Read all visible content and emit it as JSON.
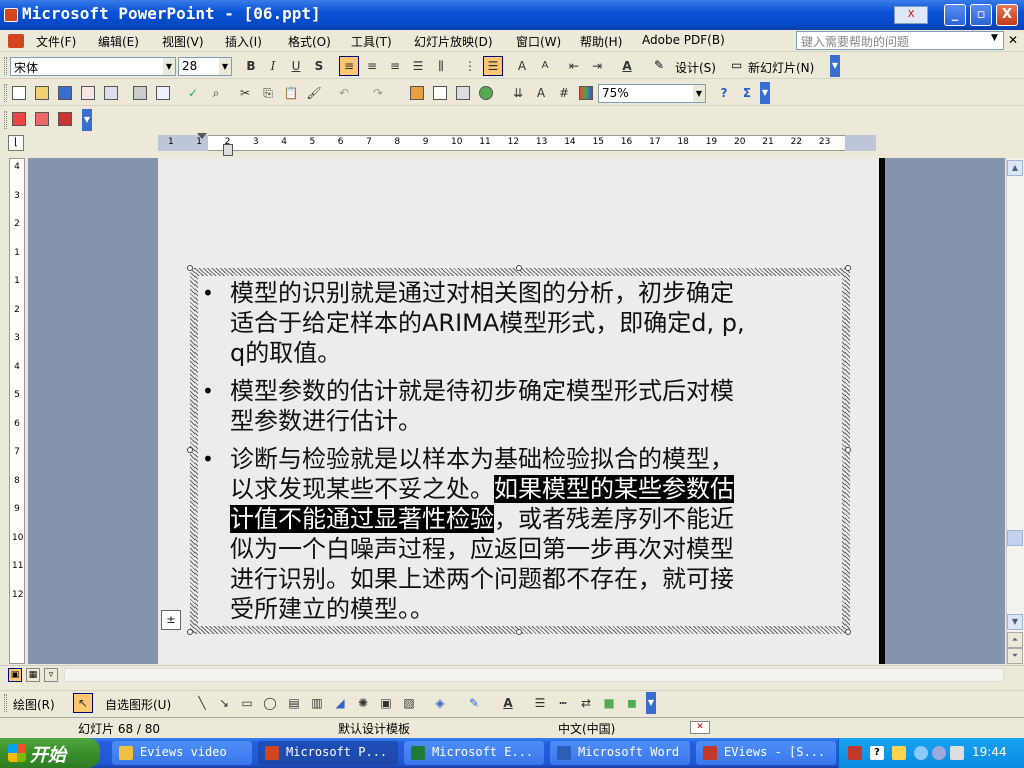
{
  "window": {
    "title": "Microsoft PowerPoint - [06.ppt]",
    "help_badge": "X",
    "minimize": "_",
    "maximize": "▫",
    "close": "X"
  },
  "menu": {
    "items": [
      "文件(F)",
      "编辑(E)",
      "视图(V)",
      "插入(I)",
      "格式(O)",
      "工具(T)",
      "幻灯片放映(D)",
      "窗口(W)",
      "帮助(H)",
      "Adobe PDF(B)"
    ],
    "help_placeholder": "键入需要帮助的问题"
  },
  "formatting": {
    "font": "宋体",
    "size": "28",
    "bold": "B",
    "italic": "I",
    "underline": "U",
    "shadow": "S",
    "design_label": "设计(S)",
    "new_slide_label": "新幻灯片(N)"
  },
  "standard": {
    "zoom": "75%",
    "sigma": "Σ"
  },
  "ruler": {
    "h_numbers": [
      "1",
      "1",
      "2",
      "3",
      "4",
      "5",
      "6",
      "7",
      "8",
      "9",
      "10",
      "11",
      "12",
      "13",
      "14",
      "15",
      "16",
      "17",
      "18",
      "19",
      "20",
      "21",
      "22",
      "23"
    ],
    "v_numbers": [
      "4",
      "3",
      "2",
      "1",
      "1",
      "2",
      "3",
      "4",
      "5",
      "6",
      "7",
      "8",
      "9",
      "10",
      "11",
      "12"
    ]
  },
  "slide": {
    "bullets": [
      {
        "lines": [
          "模型的识别就是通过对相关图的分析，初步确定",
          "适合于给定样本的ARIMA模型形式，即确定d, p,",
          "q的取值。"
        ]
      },
      {
        "lines": [
          "模型参数的估计就是待初步确定模型形式后对模",
          "型参数进行估计。"
        ]
      },
      {
        "line1": "诊断与检验就是以样本为基础检验拟合的模型，",
        "line2_plain": "以求发现某些不妥之处。",
        "line2_highlight": "如果模型的某些参数估",
        "line3_highlight": "计值不能通过显著性检验",
        "line3_plain": "，或者残差序列不能近",
        "lines_rest": [
          "似为一个白噪声过程，应返回第一步再次对模型",
          "进行识别。如果上述两个问题都不存在，就可接",
          "受所建立的模型。。"
        ]
      }
    ],
    "bullet_char": "•"
  },
  "drawing": {
    "draw_label": "绘图(R)",
    "autoshapes_label": "自选图形(U)"
  },
  "status": {
    "slide_info": "幻灯片 68 / 80",
    "template": "默认设计模板",
    "language": "中文(中国)"
  },
  "taskbar": {
    "start": "开始",
    "tasks": [
      {
        "label": "Eviews video",
        "color": "#f0c040"
      },
      {
        "label": "Microsoft P...",
        "color": "#d2451e"
      },
      {
        "label": "Microsoft E...",
        "color": "#1f7a3a"
      },
      {
        "label": "Microsoft Word",
        "color": "#2b5fb8"
      },
      {
        "label": "EViews - [S...",
        "color": "#c0392b"
      }
    ],
    "clock": "19:44"
  }
}
